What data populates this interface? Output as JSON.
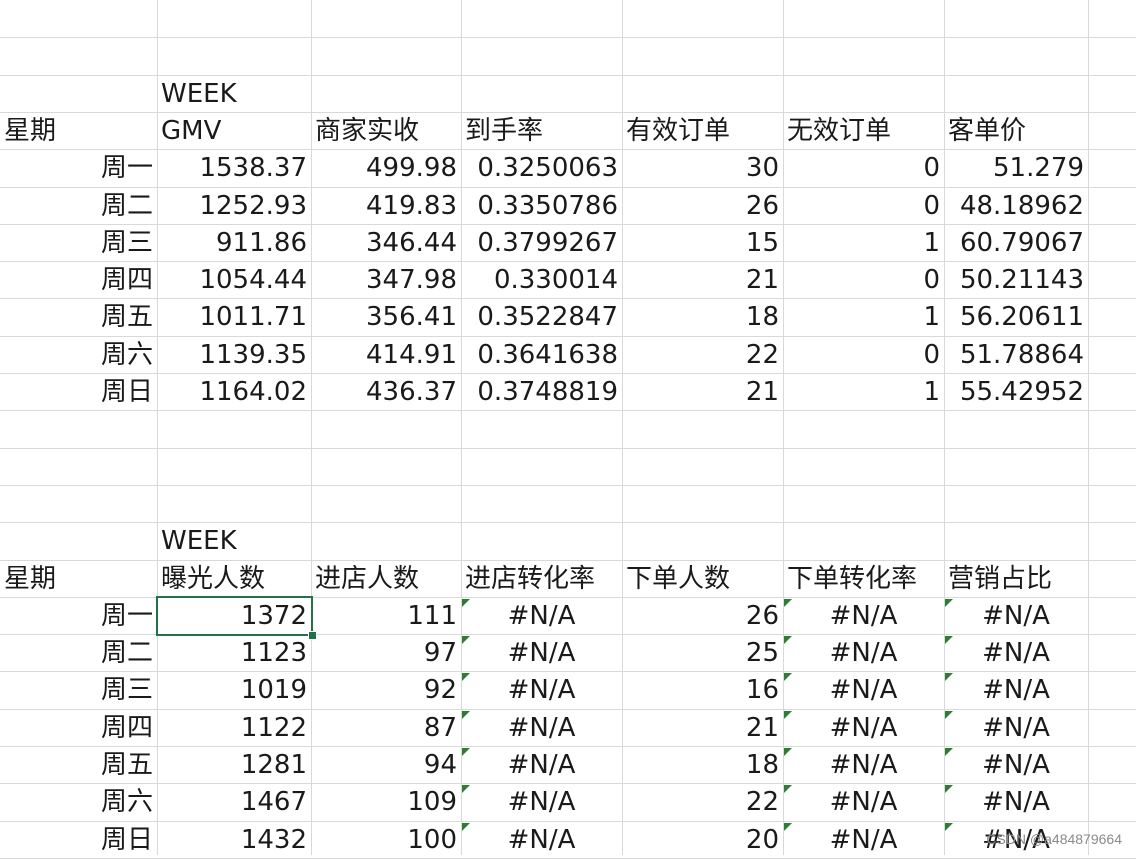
{
  "top": {
    "week_label": "WEEK",
    "headers": [
      "星期",
      "GMV",
      "商家实收",
      "到手率",
      "有效订单",
      "无效订单",
      "客单价"
    ],
    "rows": [
      [
        "周一",
        "1538.37",
        "499.98",
        "0.3250063",
        "30",
        "0",
        "51.279"
      ],
      [
        "周二",
        "1252.93",
        "419.83",
        "0.3350786",
        "26",
        "0",
        "48.18962"
      ],
      [
        "周三",
        "911.86",
        "346.44",
        "0.3799267",
        "15",
        "1",
        "60.79067"
      ],
      [
        "周四",
        "1054.44",
        "347.98",
        "0.330014",
        "21",
        "0",
        "50.21143"
      ],
      [
        "周五",
        "1011.71",
        "356.41",
        "0.3522847",
        "18",
        "1",
        "56.20611"
      ],
      [
        "周六",
        "1139.35",
        "414.91",
        "0.3641638",
        "22",
        "0",
        "51.78864"
      ],
      [
        "周日",
        "1164.02",
        "436.37",
        "0.3748819",
        "21",
        "1",
        "55.42952"
      ]
    ]
  },
  "bottom": {
    "week_label": "WEEK",
    "headers": [
      "星期",
      "曝光人数",
      "进店人数",
      "进店转化率",
      "下单人数",
      "下单转化率",
      "营销占比"
    ],
    "rows": [
      [
        "周一",
        "1372",
        "111",
        "#N/A",
        "26",
        "#N/A",
        "#N/A"
      ],
      [
        "周二",
        "1123",
        "97",
        "#N/A",
        "25",
        "#N/A",
        "#N/A"
      ],
      [
        "周三",
        "1019",
        "92",
        "#N/A",
        "16",
        "#N/A",
        "#N/A"
      ],
      [
        "周四",
        "1122",
        "87",
        "#N/A",
        "21",
        "#N/A",
        "#N/A"
      ],
      [
        "周五",
        "1281",
        "94",
        "#N/A",
        "18",
        "#N/A",
        "#N/A"
      ],
      [
        "周六",
        "1467",
        "109",
        "#N/A",
        "22",
        "#N/A",
        "#N/A"
      ],
      [
        "周日",
        "1432",
        "100",
        "#N/A",
        "20",
        "#N/A",
        "#N/A"
      ]
    ]
  },
  "selected_cell": "曝光人数 周一",
  "watermark": "CSDN @a484879664"
}
